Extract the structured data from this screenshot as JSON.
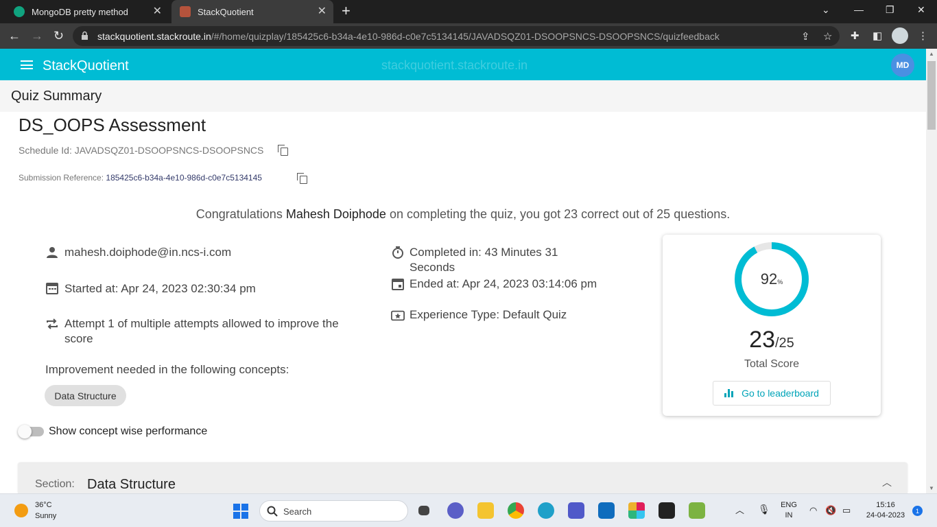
{
  "browser": {
    "tabs": [
      {
        "title": "MongoDB pretty method",
        "favicon": "openai-icon"
      },
      {
        "title": "StackQuotient",
        "favicon": "stackquotient-icon"
      }
    ],
    "url_host": "stackquotient.stackroute.in",
    "url_path": "/#/home/quizplay/185425c6-b34a-4e10-986d-c0e7c5134145/JAVADSQZ01-DSOOPSNCS-DSOOPSNCS/quizfeedback"
  },
  "app": {
    "title": "StackQuotient",
    "watermark": "stackquotient.stackroute.in",
    "avatar_initials": "MD",
    "accent_color": "#00bcd4"
  },
  "page": {
    "subheader": "Quiz Summary",
    "title": "DS_OOPS Assessment",
    "schedule_label": "Schedule Id: ",
    "schedule_value": "JAVADSQZ01-DSOOPSNCS-DSOOPSNCS",
    "submission_label": "Submission Reference: ",
    "submission_value": "185425c6-b34a-4e10-986d-c0e7c5134145"
  },
  "congrats": {
    "prefix": "Congratulations ",
    "name": "Mahesh Doiphode",
    "suffix": " on completing the quiz, you got 23 correct out of 25 questions."
  },
  "details": {
    "email": "mahesh.doiphode@in.ncs-i.com",
    "started": "Started at: Apr 24, 2023 02:30:34 pm",
    "attempt": "Attempt 1 of multiple attempts allowed to improve the score",
    "completed": "Completed in: 43 Minutes 31 Seconds",
    "ended": "Ended at: Apr 24, 2023 03:14:06 pm",
    "experience": "Experience Type: Default Quiz"
  },
  "improvement": {
    "label": "Improvement needed in the following concepts:",
    "concepts": [
      "Data Structure"
    ]
  },
  "toggle": {
    "label": "Show concept wise performance",
    "on": false
  },
  "score": {
    "percent": 92,
    "percent_text": "92",
    "percent_unit": "%",
    "correct": "23",
    "total": "/25",
    "label": "Total Score",
    "leaderboard_button": "Go to leaderboard"
  },
  "section": {
    "label": "Section:",
    "name": "Data Structure"
  },
  "taskbar": {
    "temperature": "36°C",
    "weather": "Sunny",
    "search_placeholder": "Search",
    "lang_line1": "ENG",
    "lang_line2": "IN",
    "time": "15:16",
    "date": "24-04-2023",
    "notification_count": "1"
  }
}
